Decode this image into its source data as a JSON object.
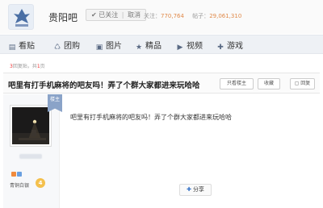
{
  "forum": {
    "name": "贵阳吧",
    "follow_label": "已关注",
    "unfollow_label": "取消",
    "stats_follow_label": "关注：",
    "stats_follow_value": "770,764",
    "stats_posts_label": "帖子：",
    "stats_posts_value": "29,061,310"
  },
  "nav": {
    "items": [
      {
        "label": "看贴",
        "icon": "book-icon"
      },
      {
        "label": "团购",
        "icon": "group-buy-icon"
      },
      {
        "label": "图片",
        "icon": "image-icon"
      },
      {
        "label": "精品",
        "icon": "star-icon"
      },
      {
        "label": "视频",
        "icon": "video-icon"
      },
      {
        "label": "游戏",
        "icon": "gamepad-icon"
      }
    ]
  },
  "pager": {
    "reply_count": "3",
    "reply_suffix": "回复贴，共",
    "page_count": "1",
    "page_suffix": "页"
  },
  "thread": {
    "title": "吧里有打手机麻将的吧友吗！弄了个群大家都进来玩哈哈",
    "only_op_label": "只看楼主",
    "favorite_label": "收藏",
    "reply_label": "回复"
  },
  "post": {
    "ribbon_label": "楼主",
    "content": "吧里有打手机麻将的吧友吗！弄了个群大家都进来玩哈哈",
    "level_label": "青铜白银",
    "level_number": "4",
    "share_label": "分享"
  },
  "colors": {
    "accent_blue": "#2f6dc5",
    "stat_orange": "#e08a4a",
    "nav_bg": "#eef1f5"
  }
}
